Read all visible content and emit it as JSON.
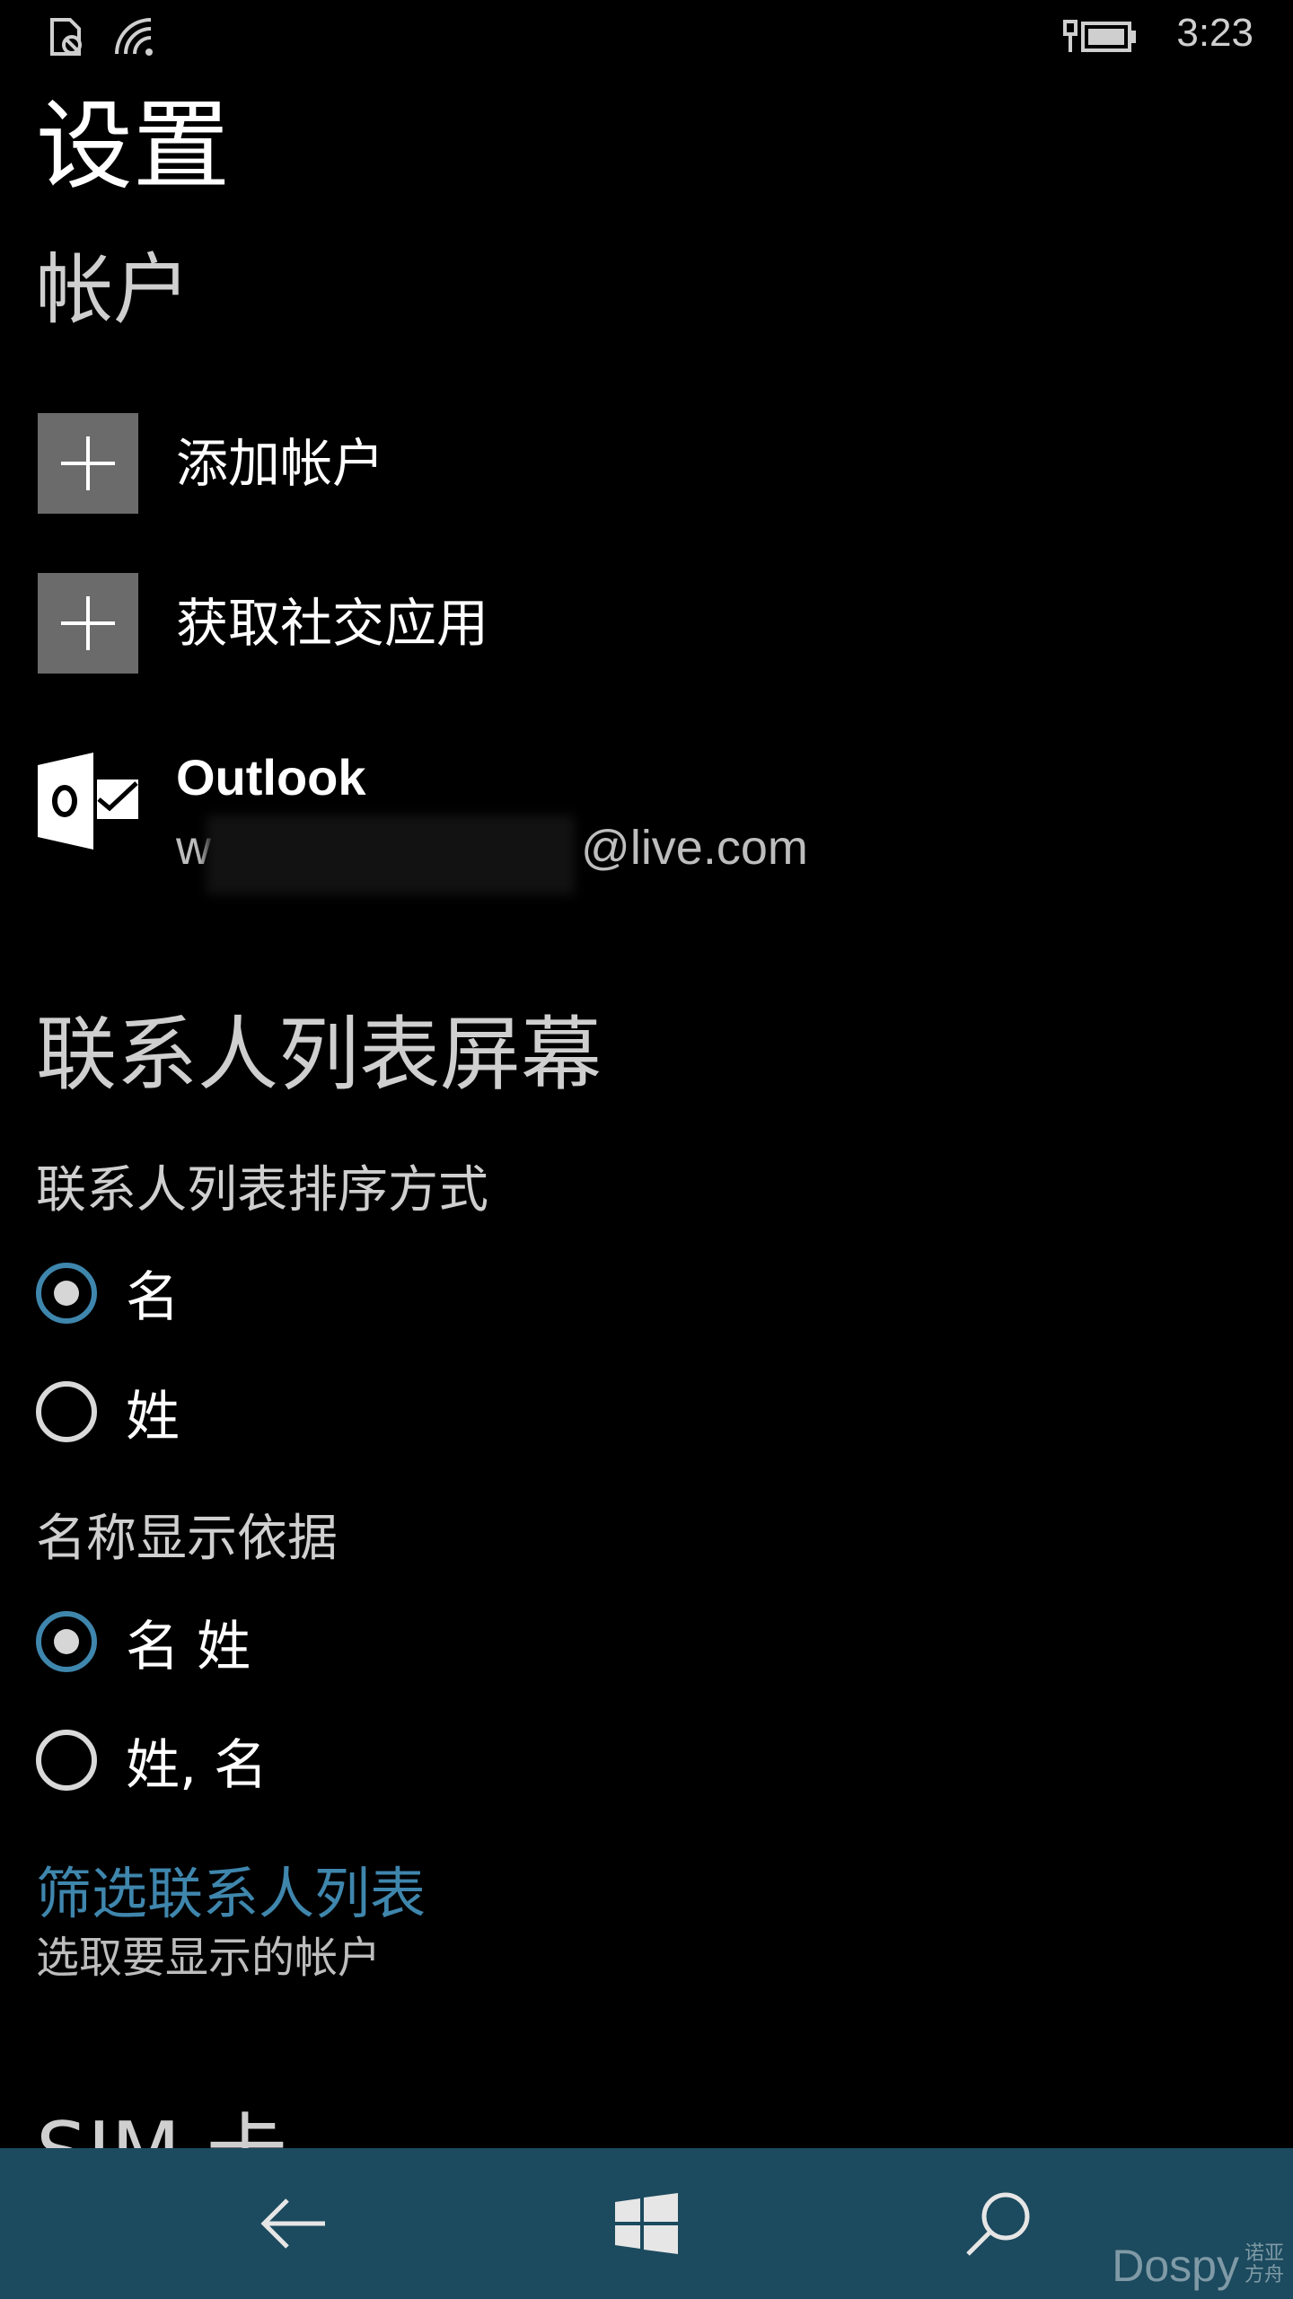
{
  "status_bar": {
    "time": "3:23",
    "icons": [
      "sim-card-no-service-icon",
      "wifi-signal-icon",
      "charging-icon",
      "battery-icon"
    ]
  },
  "page": {
    "title": "设置"
  },
  "accounts": {
    "header": "帐户",
    "add_account_label": "添加帐户",
    "get_social_apps_label": "获取社交应用",
    "outlook": {
      "name": "Outlook",
      "email_prefix": "w",
      "email_suffix": "@live.com"
    }
  },
  "contact_list": {
    "header": "联系人列表屏幕",
    "sort_by": {
      "label": "联系人列表排序方式",
      "options": [
        {
          "label": "名",
          "selected": true
        },
        {
          "label": "姓",
          "selected": false
        }
      ]
    },
    "display_by": {
      "label": "名称显示依据",
      "options": [
        {
          "label": "名 姓",
          "selected": true
        },
        {
          "label": "姓, 名",
          "selected": false
        }
      ]
    },
    "filter": {
      "link": "筛选联系人列表",
      "description": "选取要显示的帐户"
    }
  },
  "sim_section": {
    "header": "SIM 卡"
  },
  "nav_bar": {
    "back": "back-arrow-icon",
    "start": "windows-logo-icon",
    "search": "search-icon"
  },
  "watermark": {
    "brand": "Dospy",
    "sub": "诺亚方舟"
  },
  "colors": {
    "background": "#000000",
    "accent": "#3f86ad",
    "tile_gray": "#6b6b6b",
    "nav_bar": "#1c4a5e"
  }
}
